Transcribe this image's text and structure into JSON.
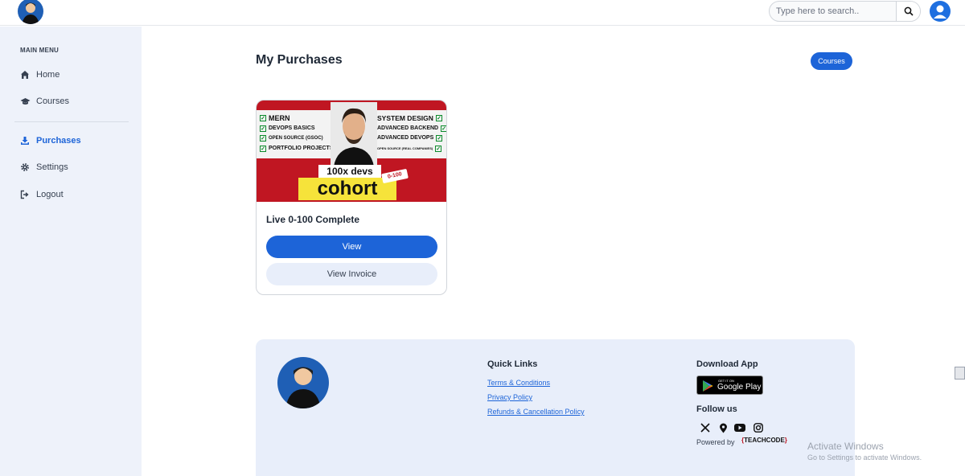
{
  "header": {
    "search_placeholder": "Type here to search..",
    "icons": {
      "logo": "profile-photo",
      "search": "search-icon",
      "user": "user-avatar-icon"
    }
  },
  "sidebar": {
    "menu_title": "MAIN MENU",
    "items": [
      {
        "label": "Home",
        "icon": "home-icon",
        "active": false
      },
      {
        "label": "Courses",
        "icon": "graduation-cap-icon",
        "active": false
      },
      {
        "label": "Purchases",
        "icon": "download-icon",
        "active": true
      },
      {
        "label": "Settings",
        "icon": "gear-icon",
        "active": false
      },
      {
        "label": "Logout",
        "icon": "logout-icon",
        "active": false
      }
    ]
  },
  "main": {
    "title": "My Purchases",
    "courses_button": "Courses",
    "card": {
      "banner": {
        "left_list": [
          "MERN",
          "DEVOPS BASICS",
          "OPEN SOURCE (GSOC)",
          "PORTFOLIO PROJECTS"
        ],
        "right_list": [
          "SYSTEM DESIGN",
          "ADVANCED BACKEND",
          "ADVANCED DEVOPS",
          "OPEN SOURCE (REAL COMPANIES)"
        ],
        "brand_line": "100x devs",
        "cohort": "cohort",
        "tag": "0-100"
      },
      "title": "Live 0-100 Complete",
      "view_button": "View",
      "invoice_button": "View Invoice"
    }
  },
  "footer": {
    "quick_links_title": "Quick Links",
    "links": [
      "Terms & Conditions",
      "Privacy Policy",
      "Refunds & Cancellation Policy"
    ],
    "download_title": "Download App",
    "gplay_top": "GET IT ON",
    "gplay_main": "Google Play",
    "follow_title": "Follow us",
    "social_icons": [
      "x-icon",
      "location-pin-icon",
      "youtube-icon",
      "instagram-icon"
    ],
    "powered_by": "Powered by",
    "powered_brand": "TEACHCODE"
  },
  "os_overlay": {
    "activate_title": "Activate Windows",
    "activate_sub": "Go to Settings to activate Windows."
  },
  "colors": {
    "primary": "#1d64d8",
    "sidebar_bg": "#eef2fa",
    "footer_bg": "#e8eefa",
    "banner_red": "#c01622"
  }
}
